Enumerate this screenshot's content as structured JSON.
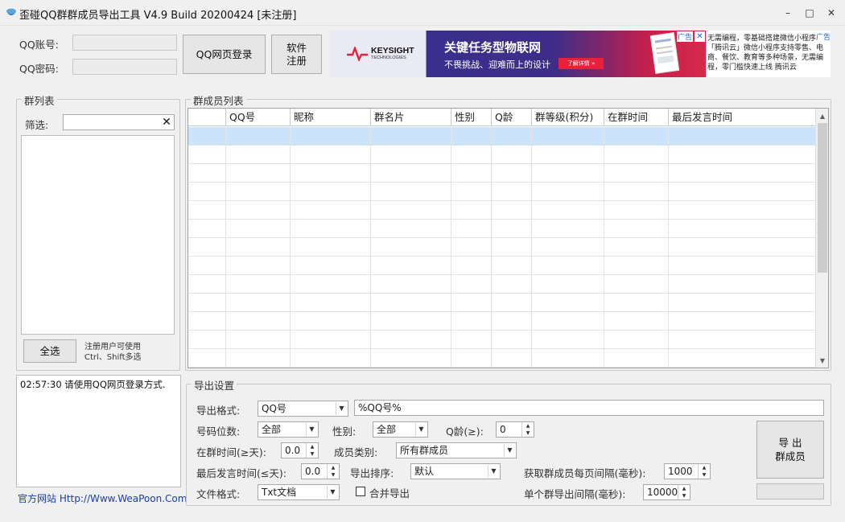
{
  "window": {
    "title": "歪碰QQ群群成员导出工具 V4.9 Build 20200424 [未注册]",
    "minimize": "–",
    "maximize": "□",
    "close": "✕"
  },
  "login": {
    "account_label": "QQ账号:",
    "password_label": "QQ密码:",
    "account_value": "",
    "password_value": "",
    "web_login_button": "QQ网页登录",
    "register_button": "软件\n注册"
  },
  "ad_banner": {
    "brand": "KEYSIGHT",
    "brand_sub": "TECHNOLOGIES",
    "headline": "关键任务型物联网",
    "subline": "不畏挑战、迎难而上的设计",
    "cta": "了解详情 »",
    "badge": "广告",
    "badge_right": "广告",
    "accent": "#e8203a",
    "bg_left": "#2c2f8f",
    "text_ad": "无需编程，零基础搭建微信小程序「腾讯云」微信小程序支持零售、电商、餐饮、教育等多种场景，无需编程，零门槛快速上线 腾讯云"
  },
  "group_list": {
    "title": "群列表",
    "filter_label": "筛选:",
    "filter_value": "",
    "select_all_button": "全选",
    "hint": "注册用户可使用\nCtrl、Shift多选"
  },
  "member_list": {
    "title": "群成员列表",
    "columns": [
      "",
      "QQ号",
      "昵称",
      "群名片",
      "性别",
      "Q龄",
      "群等级(积分)",
      "在群时间",
      "最后发言时间"
    ],
    "row_count": 13
  },
  "log": {
    "lines": [
      "02:57:30 请使用QQ网页登录方式."
    ]
  },
  "footer": {
    "website": "官方网站 Http://Www.WeaPoon.Com",
    "link_color": "#1a3fa8"
  },
  "export_settings": {
    "title": "导出设置",
    "format_label": "导出格式:",
    "format_value": "QQ号",
    "format_template": "%QQ号%",
    "digits_label": "号码位数:",
    "digits_value": "全部",
    "gender_label": "性别:",
    "gender_value": "全部",
    "qage_label": "Q龄(≥):",
    "qage_value": "0",
    "in_group_label": "在群时间(≥天):",
    "in_group_value": "0.0",
    "member_type_label": "成员类别:",
    "member_type_value": "所有群成员",
    "last_speak_label": "最后发言时间(≤天):",
    "last_speak_value": "0.0",
    "sort_label": "导出排序:",
    "sort_value": "默认",
    "page_interval_label": "获取群成员每页间隔(毫秒):",
    "page_interval_value": "1000",
    "file_format_label": "文件格式:",
    "file_format_value": "Txt文档",
    "merge_label": "合并导出",
    "group_interval_label": "单个群导出间隔(毫秒):",
    "group_interval_value": "10000",
    "export_button": "导  出\n群成员"
  }
}
